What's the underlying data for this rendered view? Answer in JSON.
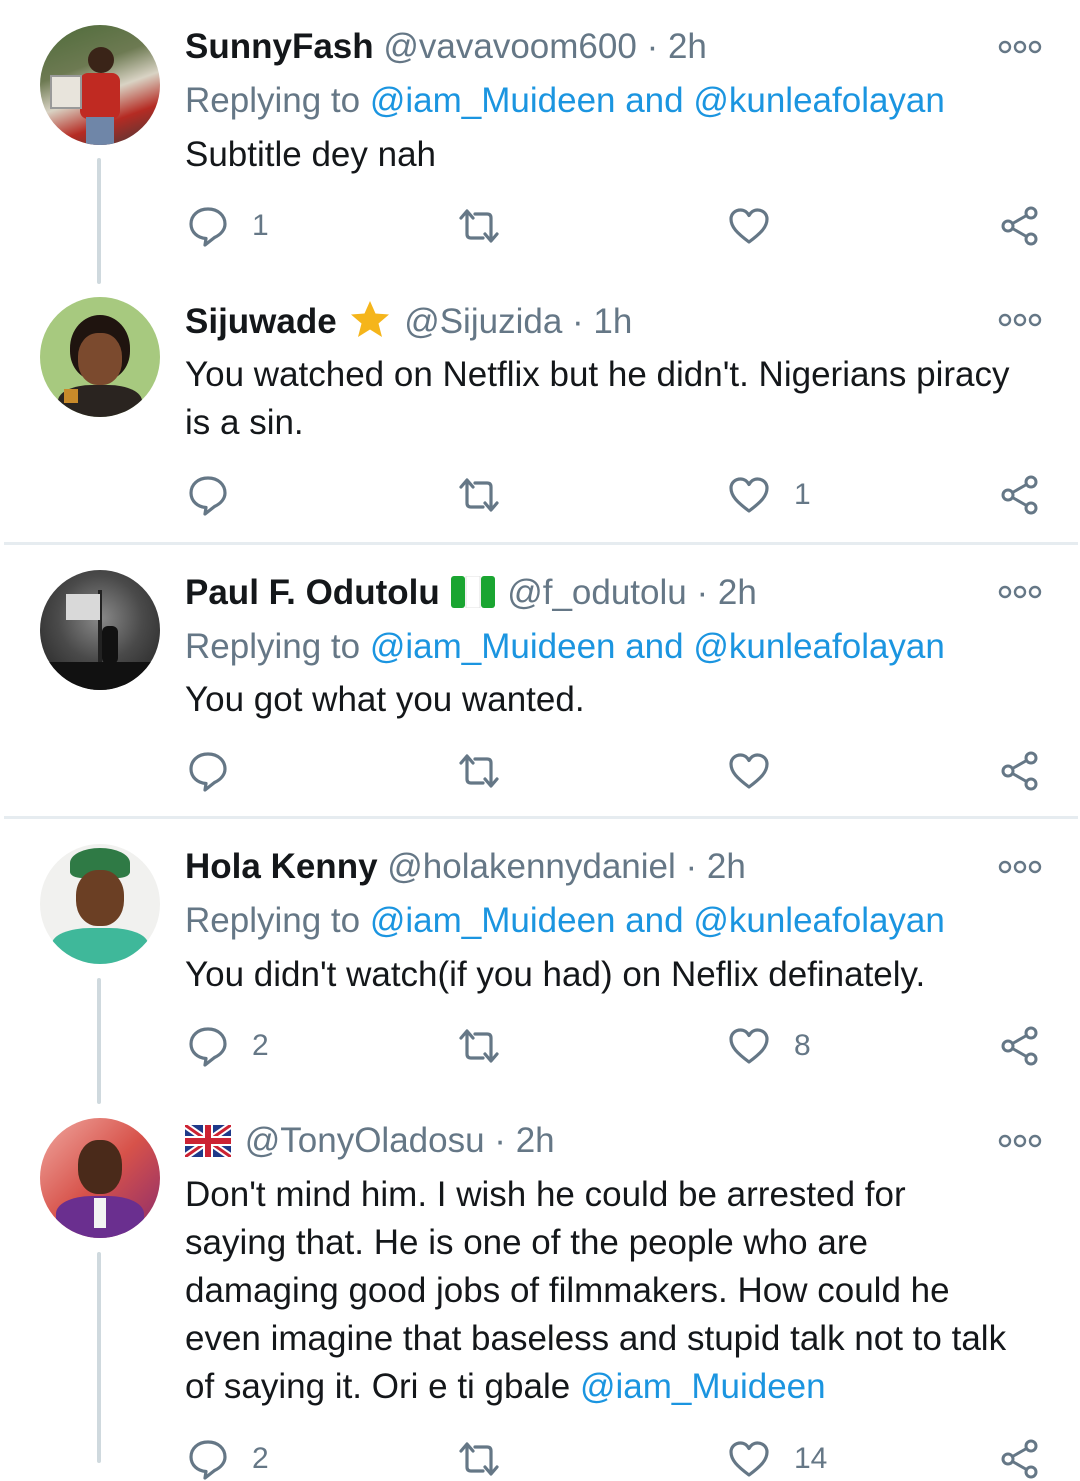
{
  "tweets": [
    {
      "name": "SunnyFash",
      "handle": "@vavavoom600",
      "time": "2h",
      "reply_prefix": "Replying to",
      "reply_targets": "@iam_Muideen and @kunleafolayan",
      "text": "Subtitle dey nah",
      "replies": "1",
      "retweets": "",
      "likes": ""
    },
    {
      "name": "Sijuwade",
      "handle": "@Sijuzida",
      "time": "1h",
      "text": "You watched on Netflix but he didn't. Nigerians piracy is a sin.",
      "replies": "",
      "retweets": "",
      "likes": "1"
    },
    {
      "name": "Paul F. Odutolu",
      "handle": "@f_odutolu",
      "time": "2h",
      "reply_prefix": "Replying to",
      "reply_targets": "@iam_Muideen and @kunleafolayan",
      "text": "You got what you wanted.",
      "replies": "",
      "retweets": "",
      "likes": ""
    },
    {
      "name": "Hola Kenny",
      "handle": "@holakennydaniel",
      "time": "2h",
      "reply_prefix": "Replying to",
      "reply_targets": "@iam_Muideen and @kunleafolayan",
      "text": "You didn't watch(if you had) on Neflix definately.",
      "replies": "2",
      "retweets": "",
      "likes": "8"
    },
    {
      "name": "",
      "handle": "@TonyOladosu",
      "time": "2h",
      "text": "Don't mind him. I wish he could be arrested for saying that. He is one of the people who are damaging good jobs of filmmakers. How could he even imagine that baseless and stupid talk not to talk of saying it. Ori e ti gbale",
      "text_mention": "@iam_Muideen",
      "replies": "2",
      "retweets": "",
      "likes": "14"
    }
  ],
  "separator_dot": "·",
  "icons": {
    "reply": "reply-icon",
    "retweet": "retweet-icon",
    "like": "heart-icon",
    "share": "share-icon",
    "more": "more-options-icon",
    "verified_star": "star-emoji-icon",
    "flag_ng": "nigeria-flag-icon",
    "flag_uk": "uk-flag-icon"
  },
  "colors": {
    "link": "#1b95e0",
    "secondary": "#657786",
    "thread_line": "#cfd9de",
    "separator": "#e6ecf0",
    "star": "#f5b51b",
    "nigeria_green": "#1aa531"
  }
}
